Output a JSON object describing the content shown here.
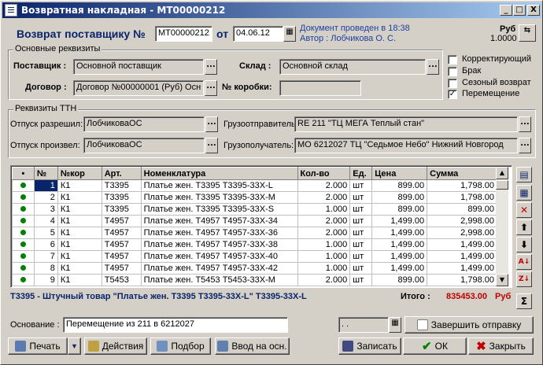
{
  "window": {
    "title": "Возвратная накладная - МТ00000212",
    "minimize": "_",
    "maximize": "□",
    "close": "X"
  },
  "header": {
    "heading": "Возврат поставщику №",
    "number": "МТ00000212",
    "from": "от",
    "date": "04.06.12",
    "status_line1": "Документ проведен в 18:38",
    "status_line2": "Автор : Лобчикова О. С.",
    "currency": "Руб",
    "rate": "1.0000"
  },
  "main_group": {
    "title": "Основные реквизиты",
    "supplier_label": "Поставщик :",
    "supplier": "Основной поставщик",
    "warehouse_label": "Склад :",
    "warehouse": "Основной склад",
    "contract_label": "Договор :",
    "contract": "Договор №00000001 (Руб)  Осн",
    "box_label": "№ коробки:",
    "box": ""
  },
  "flags": [
    {
      "label": "Корректирующий",
      "checked": false
    },
    {
      "label": "Брак",
      "checked": false
    },
    {
      "label": "Сезоный возврат",
      "checked": false
    },
    {
      "label": "Перемещение",
      "checked": true
    }
  ],
  "ttn": {
    "title": "Реквизиты ТТН",
    "allowed_label": "Отпуск разрешил:",
    "allowed": "ЛобчиковаОС",
    "made_label": "Отпуск произвел:",
    "made": "ЛобчиковаОС",
    "shipper_label": "Грузоотправитель:",
    "shipper": "RE 211 \"ТЦ МЕГА Теплый стан\"",
    "consignee_label": "Грузополучатель:",
    "consignee": "МО 6212027 ТЦ \"Седьмое Небо\" Нижний Новгород"
  },
  "table": {
    "headers": [
      "•",
      "№",
      "№кор",
      "Арт.",
      "Номенклатура",
      "Кол-во",
      "Ед.",
      "Цена",
      "Сумма"
    ],
    "rows": [
      [
        "1",
        "К1",
        "Т3395",
        "Платье  жен. Т3395 Т3395-33Х-L",
        "2.000",
        "шт",
        "899.00",
        "1,798.00"
      ],
      [
        "2",
        "К1",
        "Т3395",
        "Платье  жен. Т3395 Т3395-33Х-M",
        "2.000",
        "шт",
        "899.00",
        "1,798.00"
      ],
      [
        "3",
        "К1",
        "Т3395",
        "Платье  жен. Т3395 Т3395-33Х-S",
        "1.000",
        "шт",
        "899.00",
        "899.00"
      ],
      [
        "4",
        "К1",
        "Т4957",
        "Платье  жен. Т4957 Т4957-33Х-34",
        "2.000",
        "шт",
        "1,499.00",
        "2,998.00"
      ],
      [
        "5",
        "К1",
        "Т4957",
        "Платье  жен. Т4957 Т4957-33Х-36",
        "2.000",
        "шт",
        "1,499.00",
        "2,998.00"
      ],
      [
        "6",
        "К1",
        "Т4957",
        "Платье  жен. Т4957 Т4957-33Х-38",
        "1.000",
        "шт",
        "1,499.00",
        "1,499.00"
      ],
      [
        "7",
        "К1",
        "Т4957",
        "Платье  жен. Т4957 Т4957-33Х-40",
        "1.000",
        "шт",
        "1,499.00",
        "1,499.00"
      ],
      [
        "8",
        "К1",
        "Т4957",
        "Платье  жен. Т4957 Т4957-33Х-42",
        "1.000",
        "шт",
        "1,499.00",
        "1,499.00"
      ],
      [
        "9",
        "К1",
        "Т5453",
        "Платье  жен. Т5453 Т5453-33Х-M",
        "2.000",
        "шт",
        "899.00",
        "1,798.00"
      ]
    ]
  },
  "footer": {
    "item_info": "Т3395 - Штучный товар \"Платье  жен. Т3395 Т3395-33Х-L\" Т3395-33Х-L",
    "total_label": "Итого :",
    "total": "835453.00",
    "total_currency": "Руб",
    "basis_label": "Основание :",
    "basis": "Перемещение из 211 в 6212027",
    "ship_date": " .  .",
    "finish_label": "Завершить отправку"
  },
  "buttons": {
    "print": "Печать",
    "actions": "Действия",
    "select": "Подбор",
    "enter_basis": "Ввод на осн.",
    "save": "Записать",
    "ok": "ОК",
    "close": "Закрыть"
  },
  "colors": {
    "title_bar": "#0a246a",
    "heading": "#0a246a",
    "status": "#1f3fa0",
    "total": "#c00000",
    "info": "#0a246a",
    "dot": "#008000"
  }
}
